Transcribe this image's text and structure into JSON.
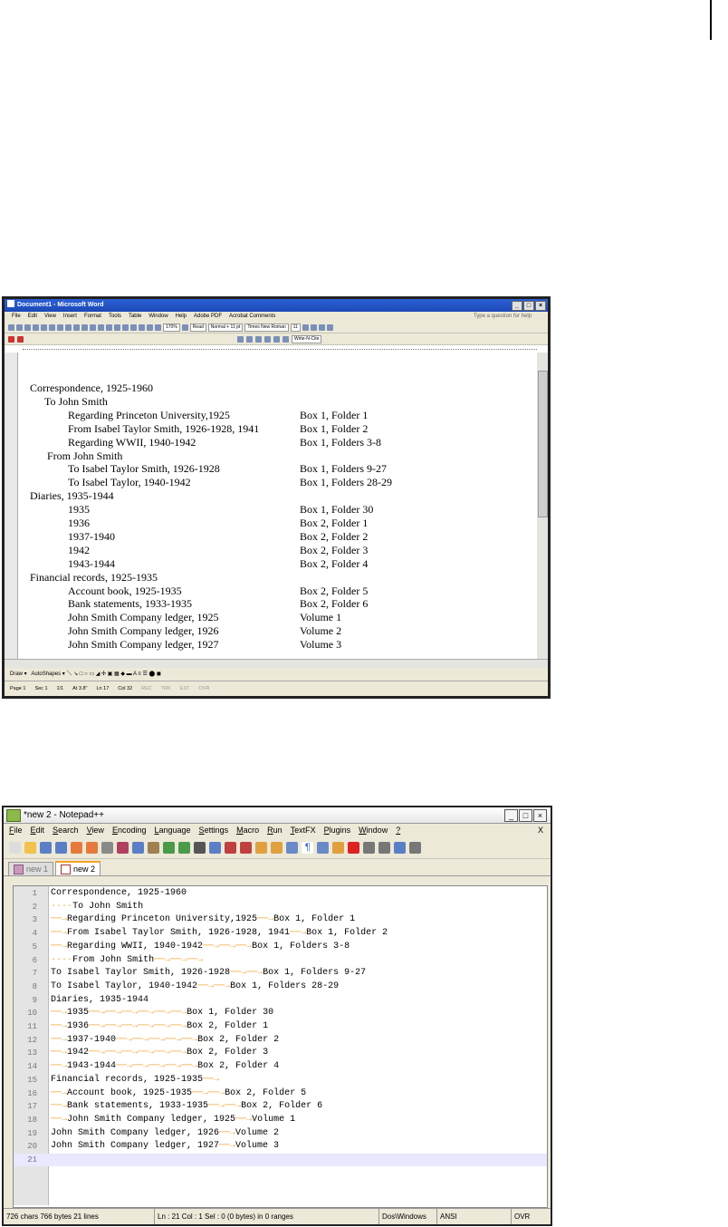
{
  "word": {
    "title": "Document1 - Microsoft Word",
    "menu": [
      "File",
      "Edit",
      "View",
      "Insert",
      "Format",
      "Tools",
      "Table",
      "Window",
      "Help",
      "Adobe PDF",
      "Acrobat Comments"
    ],
    "help_placeholder": "Type a question for help",
    "toolbar": {
      "zoom": "170%",
      "read": "Read",
      "style": "Normal + 11 pt",
      "font": "Times New Roman",
      "size": "11",
      "writeacite": "Write-N-Cite"
    },
    "lines": [
      {
        "indent": 0,
        "left": "Correspondence, 1925-1960",
        "right": ""
      },
      {
        "indent": 1,
        "left": "To John Smith",
        "right": ""
      },
      {
        "indent": 2,
        "left": "Regarding Princeton University,1925",
        "right": "Box 1, Folder 1"
      },
      {
        "indent": 2,
        "left": "From Isabel Taylor Smith, 1926-1928, 1941",
        "right": "Box 1, Folder 2"
      },
      {
        "indent": 2,
        "left": "Regarding WWII, 1940-1942",
        "right": "Box 1, Folders 3-8"
      },
      {
        "indent": 1,
        "left": "From John Smith",
        "right": ""
      },
      {
        "indent": 2,
        "left": "To Isabel Taylor Smith, 1926-1928",
        "right": "Box 1, Folders 9-27"
      },
      {
        "indent": 2,
        "left": "To Isabel Taylor, 1940-1942",
        "right": "Box 1, Folders 28-29"
      },
      {
        "indent": 0,
        "left": "Diaries, 1935-1944",
        "right": ""
      },
      {
        "indent": 2,
        "left": "1935",
        "right": "Box 1, Folder 30"
      },
      {
        "indent": 2,
        "left": "1936",
        "right": "Box 2, Folder 1"
      },
      {
        "indent": 2,
        "left": "1937-1940",
        "right": "Box 2, Folder 2"
      },
      {
        "indent": 2,
        "left": "1942",
        "right": "Box 2, Folder 3"
      },
      {
        "indent": 2,
        "left": "1943-1944",
        "right": "Box 2, Folder 4"
      },
      {
        "indent": 0,
        "left": "Financial records, 1925-1935",
        "right": ""
      },
      {
        "indent": 2,
        "left": "Account book, 1925-1935",
        "right": "Box 2, Folder 5"
      },
      {
        "indent": 2,
        "left": "Bank statements, 1933-1935",
        "right": "Box 2, Folder 6"
      },
      {
        "indent": 2,
        "left": "John Smith Company ledger, 1925",
        "right": "Volume 1"
      },
      {
        "indent": 2,
        "left": "John Smith Company ledger, 1926",
        "right": "Volume 2"
      },
      {
        "indent": 2,
        "left": "John Smith Company ledger, 1927",
        "right": "Volume 3"
      }
    ],
    "draw_label": "Draw",
    "autoshapes_label": "AutoShapes",
    "status": {
      "page": "Page 1",
      "sec": "Sec 1",
      "pages": "1/1",
      "at": "At 3.8\"",
      "ln": "Ln 17",
      "col": "Col 32",
      "rec": "REC",
      "trk": "TRK",
      "ext": "EXT",
      "ovr": "OVR"
    }
  },
  "npp": {
    "title": "*new 2 - Notepad++",
    "menu": [
      "File",
      "Edit",
      "Search",
      "View",
      "Encoding",
      "Language",
      "Settings",
      "Macro",
      "Run",
      "TextFX",
      "Plugins",
      "Window",
      "?"
    ],
    "close_doc": "X",
    "tabs": [
      {
        "label": "new 1"
      },
      {
        "label": "new 2"
      }
    ],
    "lines": [
      "Correspondence, 1925-1960",
      "····To John Smith",
      "→Regarding Princeton University,1925→Box 1, Folder 1",
      "→From Isabel Taylor Smith, 1926-1928, 1941→Box 1, Folder 2",
      "→Regarding WWII, 1940-1942→→→Box 1, Folders 3-8",
      "····From John Smith→→→",
      "To Isabel Taylor Smith, 1926-1928→→Box 1, Folders 9-27",
      "To Isabel Taylor, 1940-1942→→Box 1, Folders 28-29",
      "Diaries, 1935-1944",
      "→1935→→→→→→Box 1, Folder 30",
      "→1936→→→→→→Box 2, Folder 1",
      "→1937-1940→→→→→Box 2, Folder 2",
      "→1942→→→→→→Box 2, Folder 3",
      "→1943-1944→→→→→Box 2, Folder 4",
      "Financial records, 1925-1935→",
      "→Account book, 1925-1935→→Box 2, Folder 5",
      "→Bank statements, 1933-1935→→Box 2, Folder 6",
      "→John Smith Company ledger, 1925→Volume 1",
      "John Smith Company ledger, 1926→Volume 2",
      "John Smith Company ledger, 1927→Volume 3",
      ""
    ],
    "status": {
      "chars": "726 chars   766 bytes   21 lines",
      "pos": "Ln : 21    Col : 1    Sel : 0 (0 bytes) in 0 ranges",
      "eol": "Dos\\Windows",
      "enc": "ANSI",
      "ins": "OVR"
    }
  }
}
